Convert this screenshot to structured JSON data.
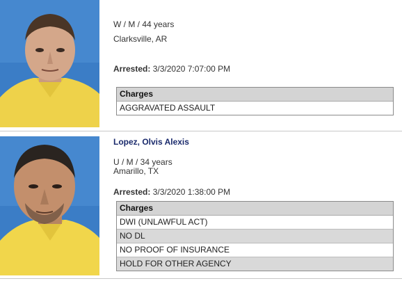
{
  "records": [
    {
      "name": "",
      "demographics": "W / M / 44 years",
      "location": "Clarksville, AR",
      "arrested_label": "Arrested:",
      "arrested_value": "3/3/2020 7:07:00 PM",
      "charges_header": "Charges",
      "charges": [
        "AGGRAVATED ASSAULT"
      ]
    },
    {
      "name": "Lopez, Olvis Alexis",
      "demographics": "U / M / 34 years",
      "location": "Amarillo, TX",
      "arrested_label": "Arrested:",
      "arrested_value": "3/3/2020 1:38:00 PM",
      "charges_header": "Charges",
      "charges": [
        "DWI (UNLAWFUL ACT)",
        "NO DL",
        "NO PROOF OF INSURANCE",
        "HOLD FOR OTHER AGENCY"
      ]
    }
  ],
  "colors": {
    "name": "#1a2a6c",
    "shirt": "#f0d64a",
    "backdrop": "#3c7fc4",
    "charges_header_bg": "#d4d4d4"
  }
}
